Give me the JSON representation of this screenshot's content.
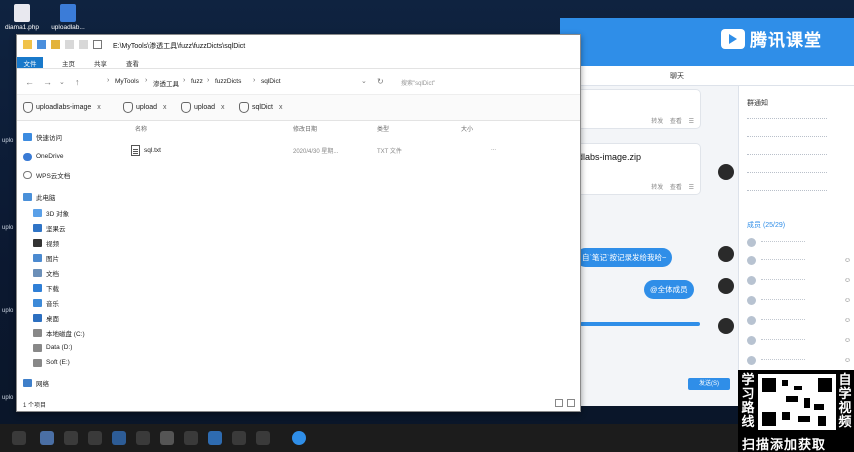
{
  "desktop": {
    "icons": [
      {
        "label": "diama1.php"
      },
      {
        "label": "uploadlab..."
      }
    ],
    "side_labels": [
      "uplo",
      "uplo",
      "uplo",
      "uplo"
    ]
  },
  "explorer": {
    "title_path": "E:\\MyTools\\渗透工具\\fuzz\\fuzzDicts\\sqlDict",
    "ribbon_tabs": [
      "文件",
      "主页",
      "共享",
      "查看"
    ],
    "breadcrumbs": [
      "MyTools",
      "渗透工具",
      "fuzz",
      "fuzzDicts",
      "sqlDict"
    ],
    "search_placeholder": "搜索\"sqlDict\"",
    "folder_tabs": [
      "uploadlabs-image",
      "upload",
      "upload",
      "sqlDict"
    ],
    "nav": {
      "quick_access": "快速访问",
      "onedrive": "OneDrive",
      "wps": "WPS云文档",
      "this_pc": "此电脑",
      "items": [
        "3D 对象",
        "坚果云",
        "视频",
        "图片",
        "文档",
        "下载",
        "音乐",
        "桌面",
        "本地磁盘 (C:)",
        "Data (D:)",
        "Soft (E:)"
      ],
      "network": "网络"
    },
    "columns": [
      "名称",
      "修改日期",
      "类型",
      "大小"
    ],
    "files": [
      {
        "name": "sql.txt",
        "date": "2020/4/30 星期...",
        "type": "TXT 文件",
        "size": "..."
      }
    ],
    "status": "1 个项目"
  },
  "chat": {
    "brand": "腾讯课堂",
    "tab_chat": "聊天",
    "actions": [
      "转发",
      "查看"
    ],
    "file_msg": "dlabs-image.zip",
    "msg_notes": "自`笔记`按记录发给我哈~",
    "msg_all": "@全体成员",
    "group_notice": "群通知",
    "members_title": "成员 (25/29)",
    "send_label": "发送(S)"
  },
  "promo": {
    "left": "学习路线",
    "right": "自学视频",
    "bottom": "扫描添加获取"
  }
}
